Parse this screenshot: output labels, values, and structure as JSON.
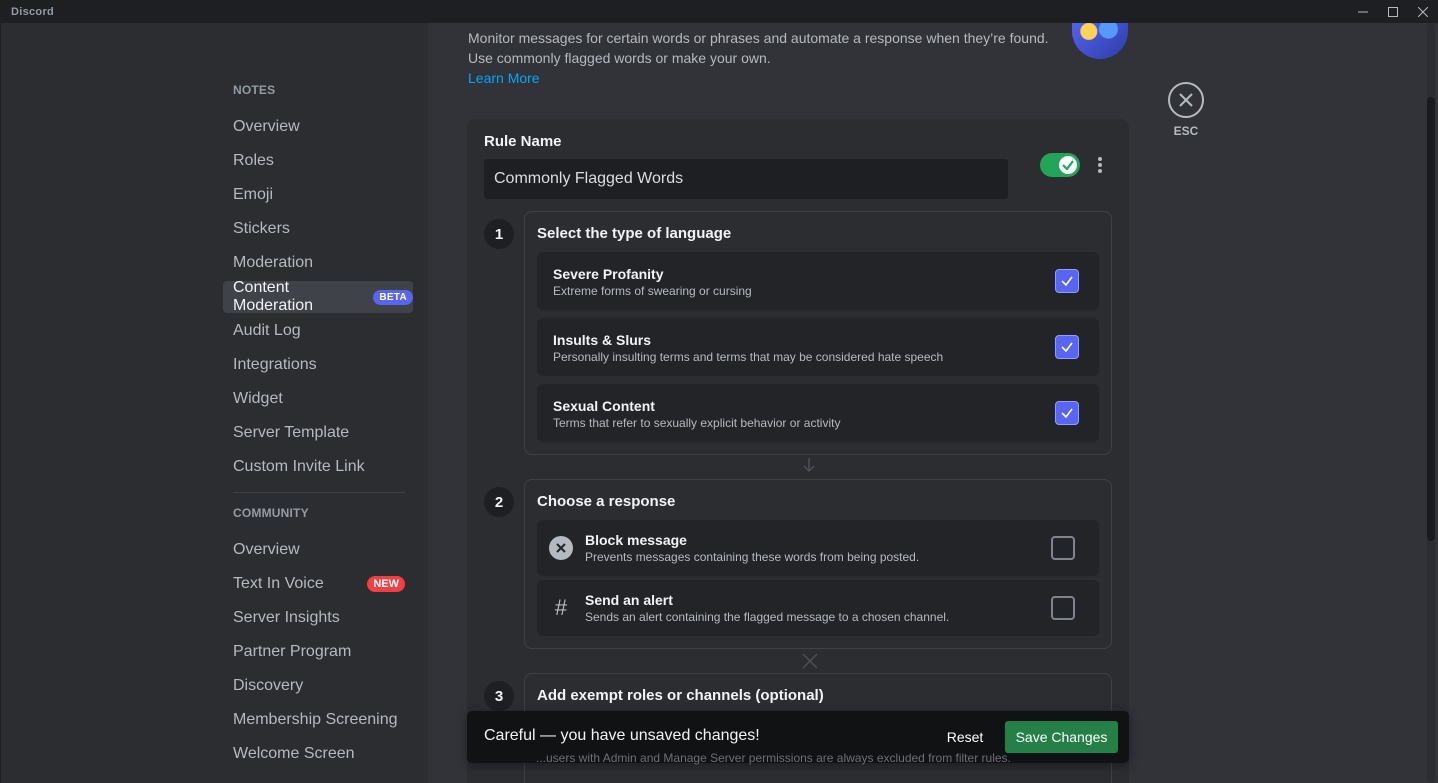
{
  "window": {
    "title": "Discord"
  },
  "colors": {
    "accent": "#5865f2",
    "success": "#23a559",
    "danger": "#f23f43",
    "link": "#00a8fc"
  },
  "sidebar": {
    "section_notes": "NOTES",
    "notes_items": [
      {
        "label": "Overview"
      },
      {
        "label": "Roles"
      },
      {
        "label": "Emoji"
      },
      {
        "label": "Stickers"
      },
      {
        "label": "Moderation"
      },
      {
        "label": "Content Moderation",
        "badge": "BETA",
        "selected": true
      },
      {
        "label": "Audit Log"
      },
      {
        "label": "Integrations"
      },
      {
        "label": "Widget"
      },
      {
        "label": "Server Template"
      },
      {
        "label": "Custom Invite Link"
      }
    ],
    "section_community": "COMMUNITY",
    "community_items": [
      {
        "label": "Overview"
      },
      {
        "label": "Text In Voice",
        "badge": "NEW"
      },
      {
        "label": "Server Insights"
      },
      {
        "label": "Partner Program"
      },
      {
        "label": "Discovery"
      },
      {
        "label": "Membership Screening"
      },
      {
        "label": "Welcome Screen"
      }
    ]
  },
  "main": {
    "intro_text": "Monitor messages for certain words or phrases and automate a response when they’re found. Use commonly flagged words or make your own.",
    "learn_more": "Learn More",
    "esc_label": "ESC",
    "rule": {
      "name_label": "Rule Name",
      "name_value": "Commonly Flagged Words",
      "enabled": true
    },
    "step1": {
      "number": "1",
      "title": "Select the type of language",
      "options": [
        {
          "title": "Severe Profanity",
          "desc": "Extreme forms of swearing or cursing",
          "checked": true
        },
        {
          "title": "Insults & Slurs",
          "desc": "Personally insulting terms and terms that may be considered hate speech",
          "checked": true
        },
        {
          "title": "Sexual Content",
          "desc": "Terms that refer to sexually explicit behavior or activity",
          "checked": true
        }
      ]
    },
    "step2": {
      "number": "2",
      "title": "Choose a response",
      "options": [
        {
          "title": "Block message",
          "desc": "Prevents messages containing these words from being posted.",
          "icon": "block-icon",
          "checked": false
        },
        {
          "title": "Send an alert",
          "desc": "Sends an alert containing the flagged message to a chosen channel.",
          "icon": "hash-icon",
          "checked": false
        }
      ]
    },
    "step3": {
      "number": "3",
      "title": "Add exempt roles or channels (optional)",
      "peek_text": "...users with Admin and Manage Server permissions are always excluded from filter rules."
    },
    "unsaved": {
      "message": "Careful — you have unsaved changes!",
      "reset_label": "Reset",
      "save_label": "Save Changes"
    }
  }
}
